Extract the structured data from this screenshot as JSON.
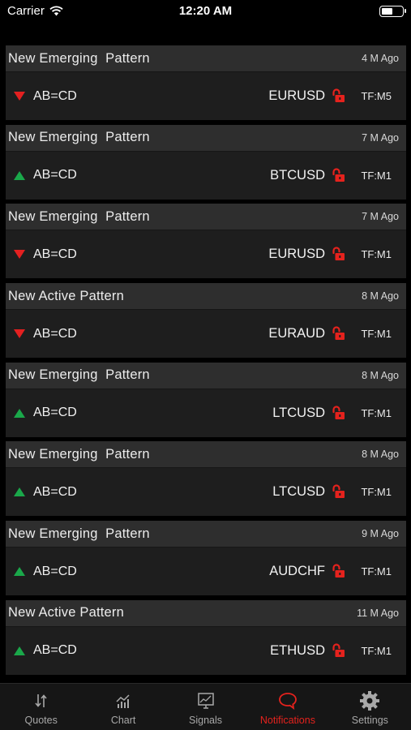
{
  "status_bar": {
    "carrier": "Carrier",
    "time": "12:20 AM",
    "battery_level": 0.55
  },
  "notifications": [
    {
      "title": "New Emerging  Pattern",
      "age": "4 M Ago",
      "direction": "down",
      "pattern": "AB=CD",
      "symbol": "EURUSD",
      "timeframe": "TF:M5"
    },
    {
      "title": "New Emerging  Pattern",
      "age": "7 M Ago",
      "direction": "up",
      "pattern": "AB=CD",
      "symbol": "BTCUSD",
      "timeframe": "TF:M1"
    },
    {
      "title": "New Emerging  Pattern",
      "age": "7 M Ago",
      "direction": "down",
      "pattern": "AB=CD",
      "symbol": "EURUSD",
      "timeframe": "TF:M1"
    },
    {
      "title": "New Active Pattern",
      "age": "8 M Ago",
      "direction": "down",
      "pattern": "AB=CD",
      "symbol": "EURAUD",
      "timeframe": "TF:M1"
    },
    {
      "title": "New Emerging  Pattern",
      "age": "8 M Ago",
      "direction": "up",
      "pattern": "AB=CD",
      "symbol": "LTCUSD",
      "timeframe": "TF:M1"
    },
    {
      "title": "New Emerging  Pattern",
      "age": "8 M Ago",
      "direction": "up",
      "pattern": "AB=CD",
      "symbol": "LTCUSD",
      "timeframe": "TF:M1"
    },
    {
      "title": "New Emerging  Pattern",
      "age": "9 M Ago",
      "direction": "up",
      "pattern": "AB=CD",
      "symbol": "AUDCHF",
      "timeframe": "TF:M1"
    },
    {
      "title": "New Active Pattern",
      "age": "11 M Ago",
      "direction": "up",
      "pattern": "AB=CD",
      "symbol": "ETHUSD",
      "timeframe": "TF:M1"
    }
  ],
  "tabs": [
    {
      "label": "Quotes",
      "icon": "quotes-icon",
      "active": false
    },
    {
      "label": "Chart",
      "icon": "chart-icon",
      "active": false
    },
    {
      "label": "Signals",
      "icon": "signals-icon",
      "active": false
    },
    {
      "label": "Notifications",
      "icon": "notifications-icon",
      "active": true
    },
    {
      "label": "Settings",
      "icon": "gear-icon",
      "active": false
    }
  ],
  "colors": {
    "accent": "#e5221d",
    "up": "#1aa84a",
    "down": "#e32020",
    "inactive": "#a8a8a8"
  }
}
